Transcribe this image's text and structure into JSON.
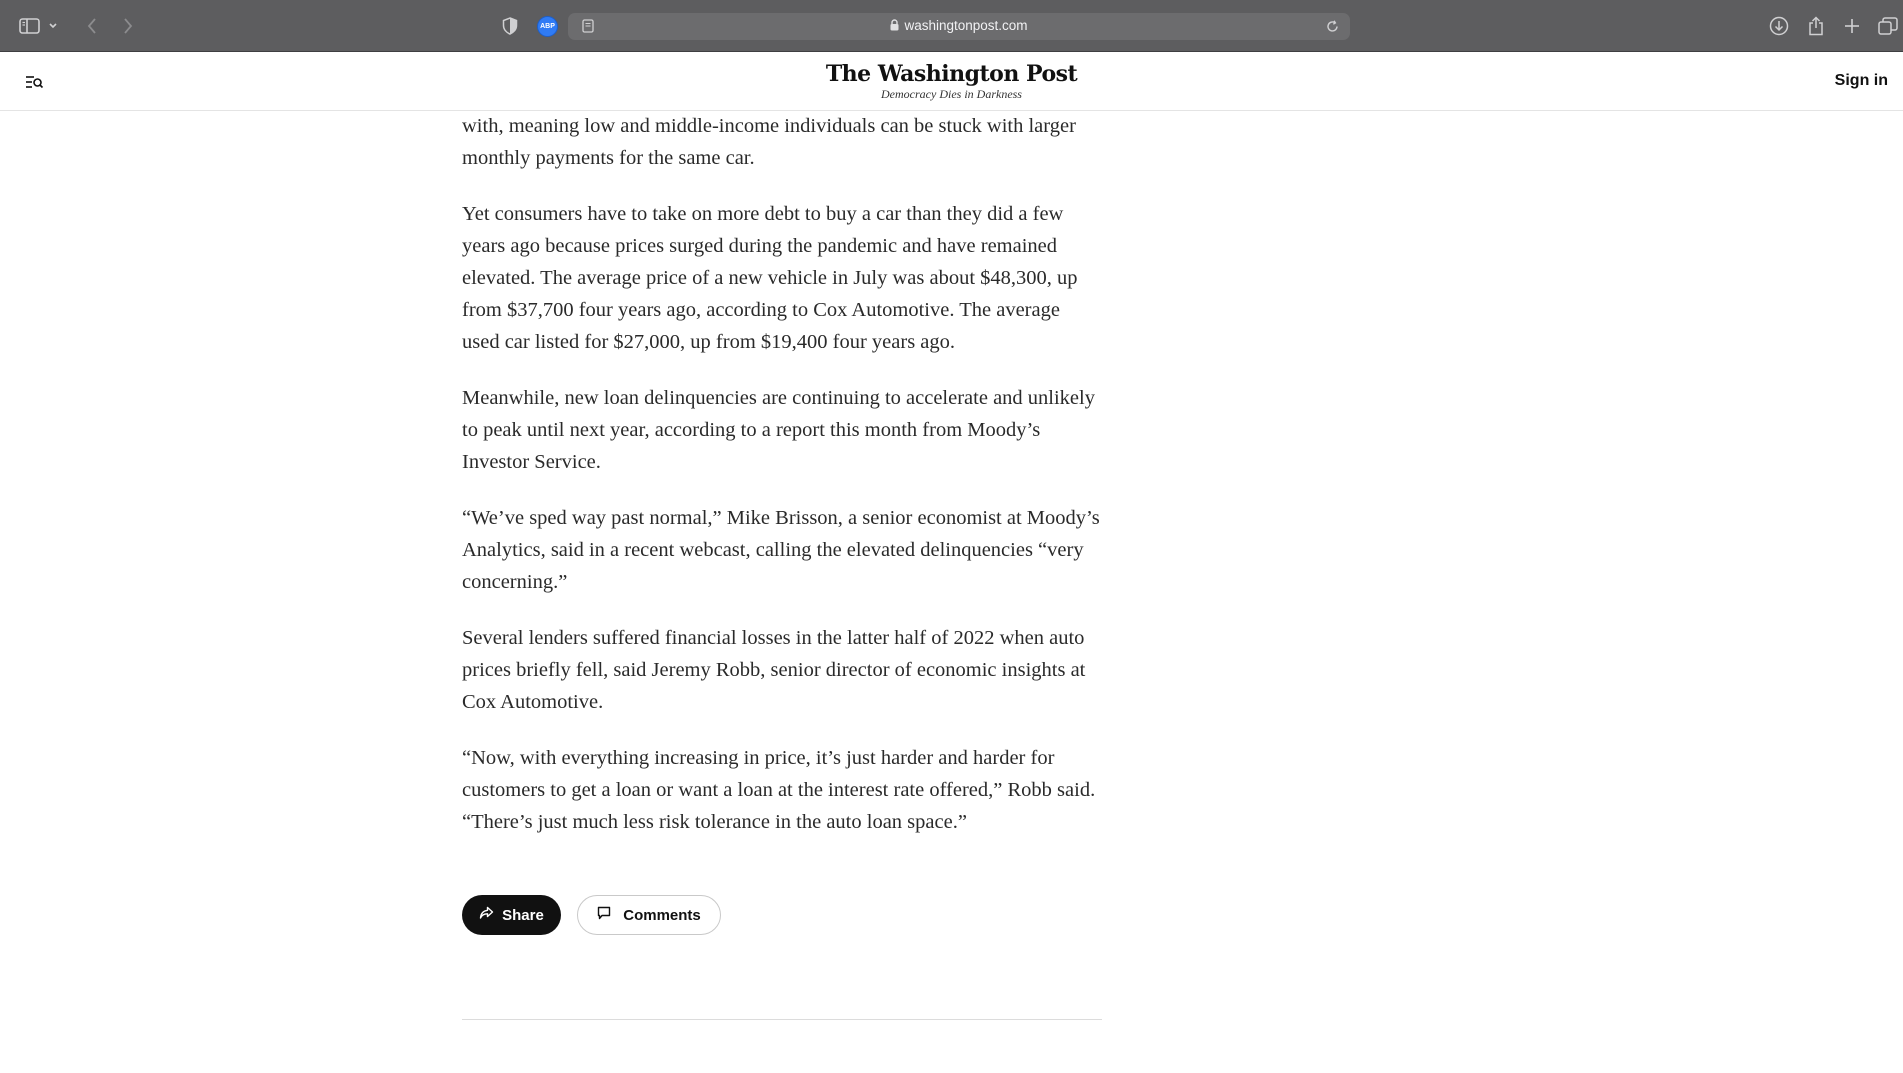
{
  "browser": {
    "url": "washingtonpost.com",
    "extension_badge": "ABP"
  },
  "header": {
    "logo": "The Washington Post",
    "tagline": "Democracy Dies in Darkness",
    "sign_in": "Sign in"
  },
  "article": {
    "paragraphs": [
      "with, meaning low and middle-income individuals can be stuck with larger monthly payments for the same car.",
      "Yet consumers have to take on more debt to buy a car than they did a few years ago because prices surged during the pandemic and have remained elevated. The average price of a new vehicle in July was about $48,300, up from $37,700 four years ago, according to Cox Automotive. The average used car listed for $27,000, up from $19,400 four years ago.",
      "Meanwhile, new loan delinquencies are continuing to accelerate and unlikely to peak until next year, according to a report this month from Moody’s Investor Service.",
      "“We’ve sped way past normal,” Mike Brisson, a senior economist at Moody’s Analytics, said in a recent webcast, calling the elevated delinquencies “very concerning.”",
      "Several lenders suffered financial losses in the latter half of 2022 when auto prices briefly fell, said Jeremy Robb, senior director of economic insights at Cox Automotive.",
      "“Now, with everything increasing in price, it’s just harder and harder for customers to get a loan or want a loan at the interest rate offered,” Robb said. “There’s just much less risk tolerance in the auto loan space.”"
    ],
    "share_label": "Share",
    "comments_label": "Comments"
  }
}
